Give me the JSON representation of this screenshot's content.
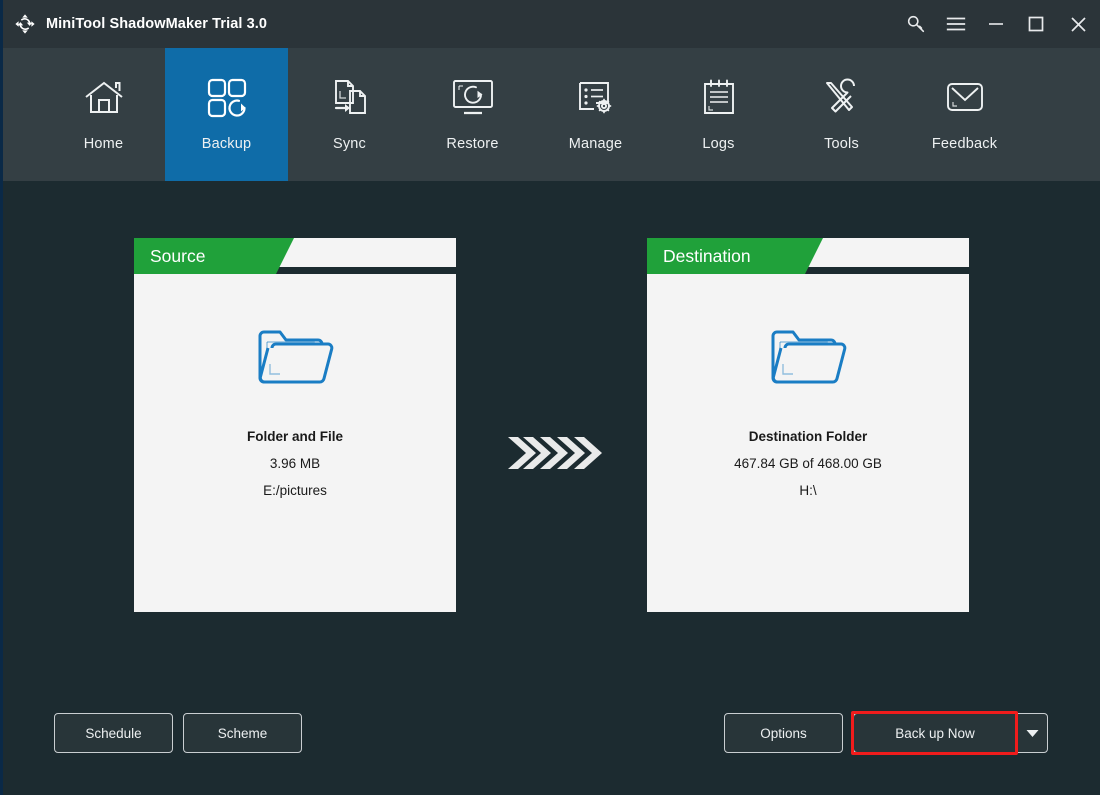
{
  "titlebar": {
    "logo_icon": "move-arrows-logo-icon",
    "title": "MiniTool ShadowMaker Trial 3.0",
    "buttons": [
      {
        "name": "key-icon",
        "label": ""
      },
      {
        "name": "menu-icon",
        "label": ""
      },
      {
        "name": "minimize-icon",
        "label": ""
      },
      {
        "name": "maximize-icon",
        "label": ""
      },
      {
        "name": "close-icon",
        "label": ""
      }
    ]
  },
  "nav": {
    "active": "Backup",
    "items": [
      {
        "label": "Home",
        "icon": "home-icon"
      },
      {
        "label": "Backup",
        "icon": "backup-grid-icon"
      },
      {
        "label": "Sync",
        "icon": "sync-files-icon"
      },
      {
        "label": "Restore",
        "icon": "restore-monitor-icon"
      },
      {
        "label": "Manage",
        "icon": "manage-list-gear-icon"
      },
      {
        "label": "Logs",
        "icon": "logs-notepad-icon"
      },
      {
        "label": "Tools",
        "icon": "tools-wrench-screwdriver-icon"
      },
      {
        "label": "Feedback",
        "icon": "feedback-envelope-icon"
      }
    ]
  },
  "main": {
    "source": {
      "tab_label": "Source",
      "icon": "folder-icon",
      "title": "Folder and File",
      "size": "3.96 MB",
      "path": "E:/pictures"
    },
    "destination": {
      "tab_label": "Destination",
      "icon": "folder-icon",
      "title": "Destination Folder",
      "size": "467.84 GB of 468.00 GB",
      "path": "H:\\"
    },
    "arrows_icon": "triple-chevron-right-icon"
  },
  "footer": {
    "schedule_label": "Schedule",
    "scheme_label": "Scheme",
    "options_label": "Options",
    "backup_now_label": "Back up Now",
    "caret_icon": "chevron-down-icon",
    "highlight_color": "#f01c1c"
  },
  "colors": {
    "titlebar_bg": "#2b3439",
    "navbar_bg": "#343f44",
    "active_tab_bg": "#0f6ca8",
    "body_bg": "#1c2b30",
    "panel_bg": "#f4f4f4",
    "tab_green": "#20a13a",
    "folder_blue": "#1a7dc4",
    "left_border": "#0a2947"
  }
}
